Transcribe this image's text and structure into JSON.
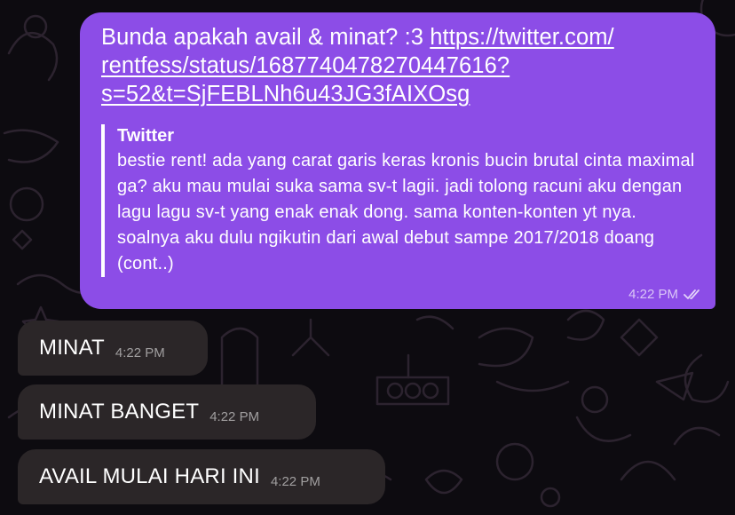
{
  "outgoing": {
    "text": "Bunda apakah avail & minat? :3 ",
    "link": "https://twitter.com/rentfess/status/1687740478270447616?s=52&t=SjFEBLNh6u43JG3fAIXOsg",
    "link_line1": "https://twitter.com/",
    "link_line2": "rentfess/status/1687740478270447616?",
    "link_line3": "s=52&t=SjFEBLNh6u43JG3fAIXOsg",
    "preview": {
      "site": "Twitter",
      "body": "bestie rent! ada yang carat garis keras kronis bucin brutal cinta maximal ga? aku mau mulai suka sama sv-t lagii. jadi tolong racuni aku dengan lagu lagu sv-t yang enak enak dong. sama konten-konten yt nya. soalnya aku dulu ngikutin dari awal debut sampe 2017/2018 doang  (cont..)"
    },
    "time": "4:22 PM",
    "status_icon": "double-check-icon"
  },
  "incoming": [
    {
      "text": "MINAT",
      "time": "4:22 PM"
    },
    {
      "text": "MINAT BANGET",
      "time": "4:22 PM"
    },
    {
      "text": "AVAIL MULAI HARI INI",
      "time": "4:22 PM"
    }
  ],
  "colors": {
    "outgoing_bubble": "#8c4de7",
    "incoming_bubble": "#2b2628",
    "background": "#0d0b10"
  }
}
